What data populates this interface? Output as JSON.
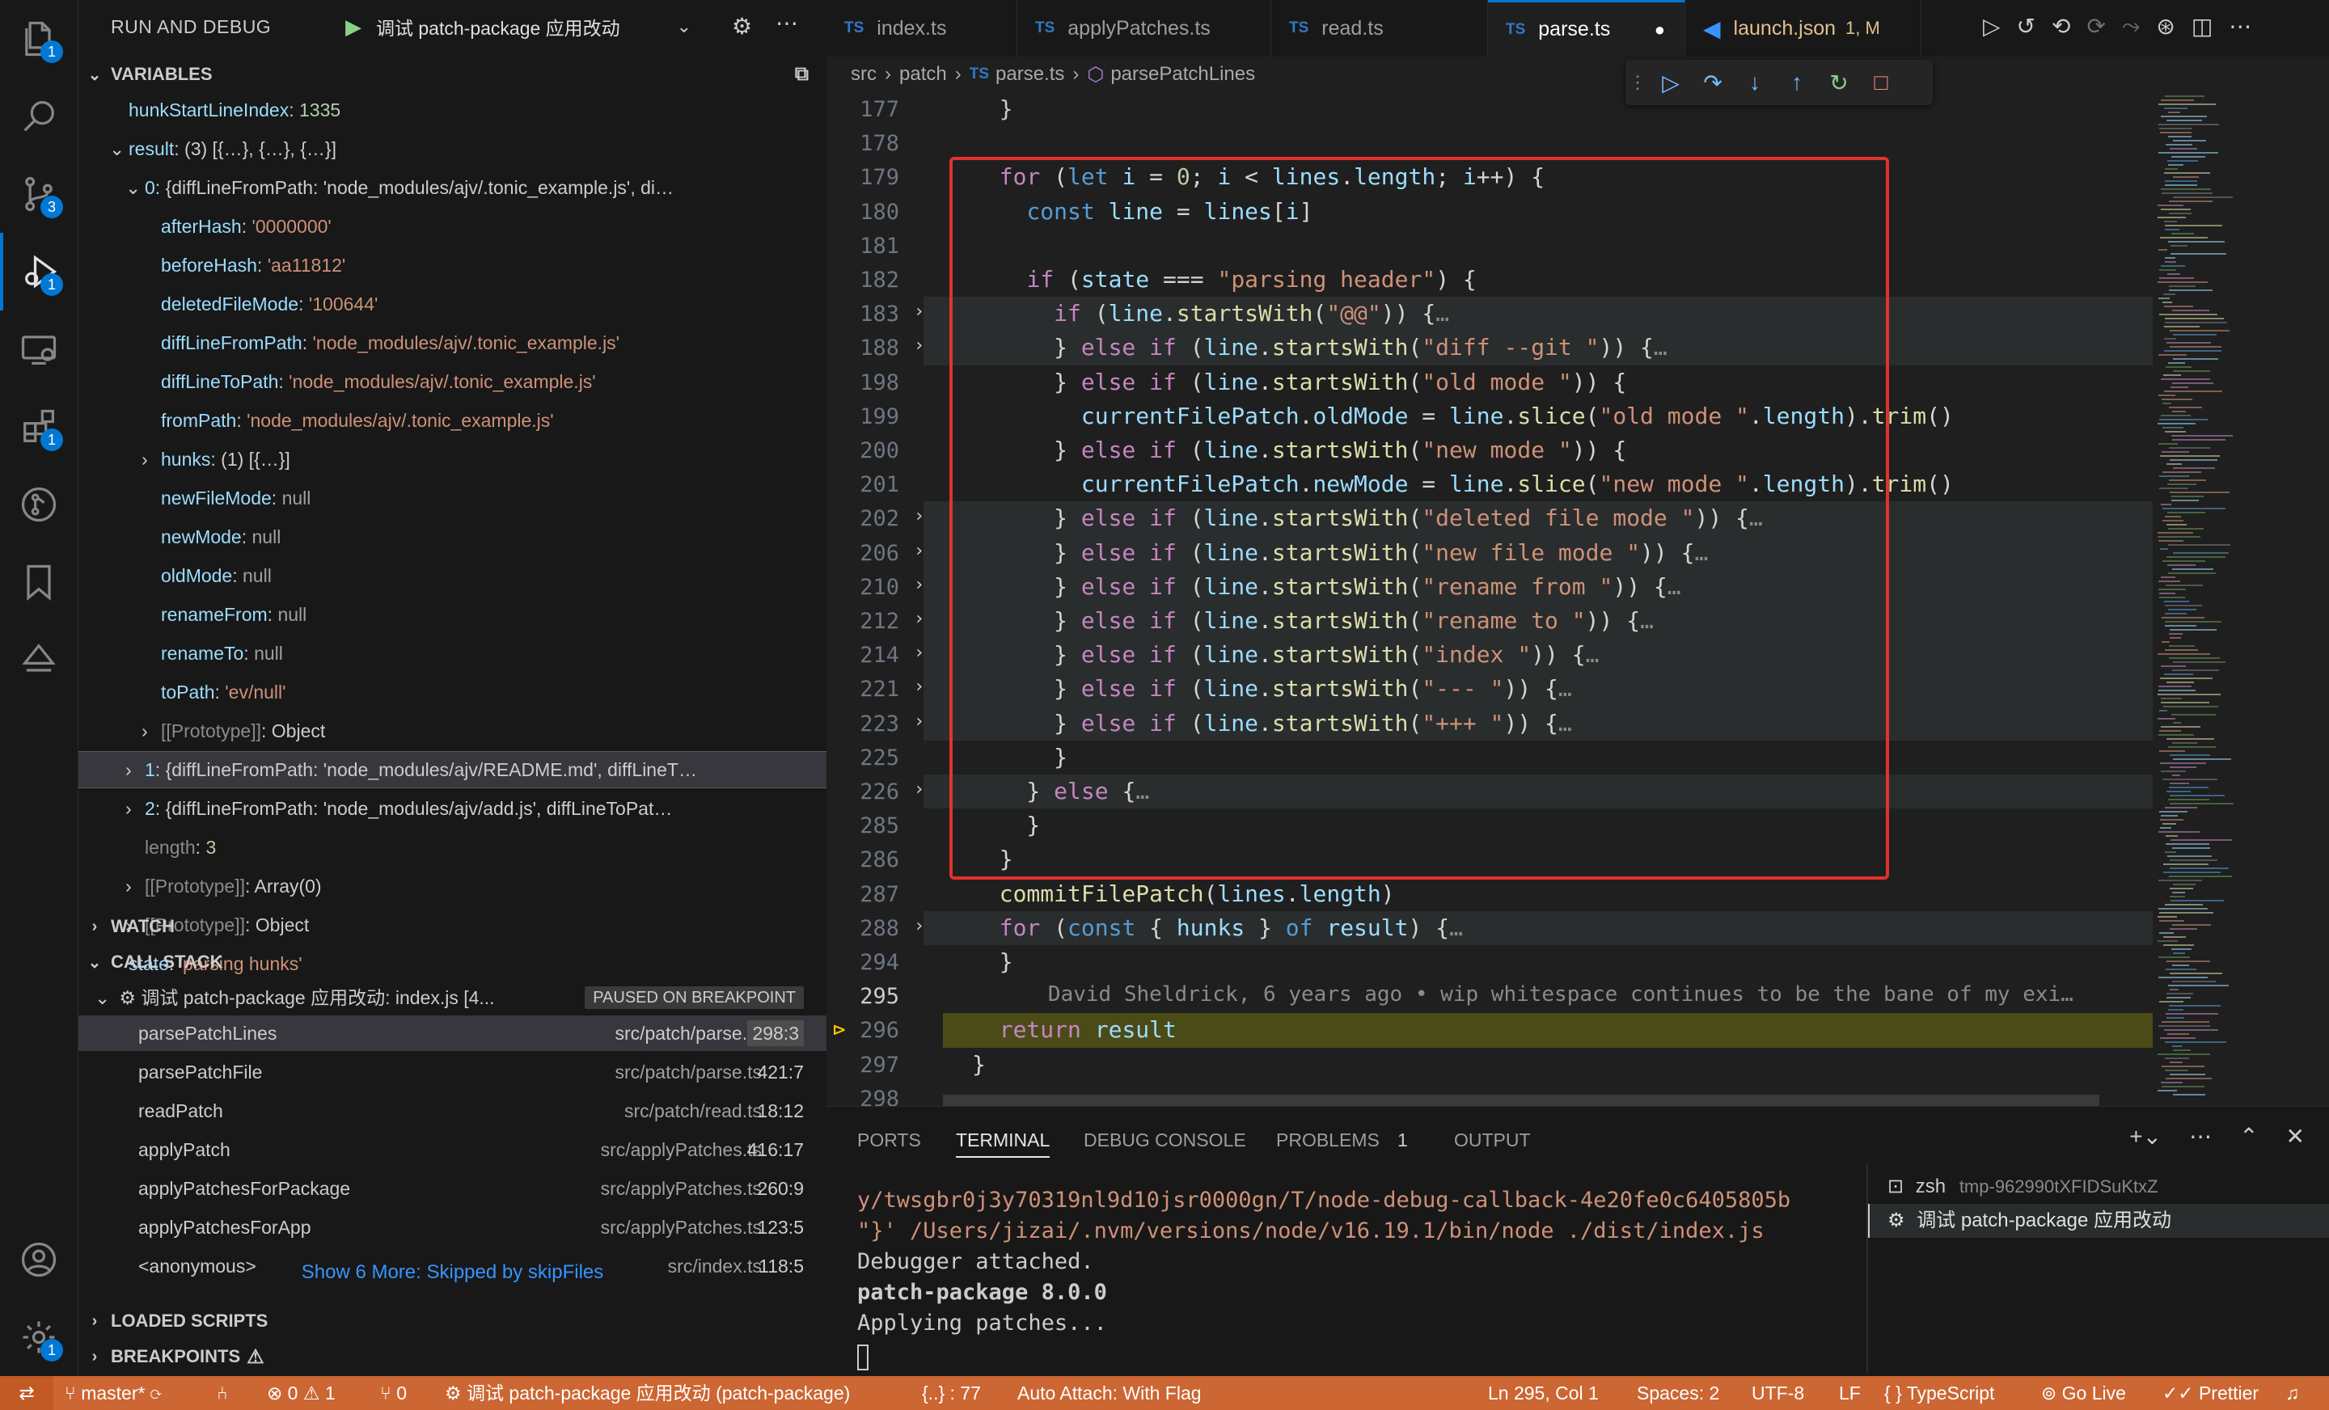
{
  "activity_bar": {
    "badges": {
      "explorer": "1",
      "source_control": "3",
      "run_debug": "1",
      "extensions": "1",
      "settings": "1"
    }
  },
  "sidebar": {
    "title": "RUN AND DEBUG",
    "config_name": "调试 patch-package 应用改动",
    "variables_header": "VARIABLES",
    "variables": [
      {
        "indent": 0,
        "twisty": "",
        "key": "hunkStartLineIndex",
        "sep": ": ",
        "value": "1335",
        "vtype": "n"
      },
      {
        "indent": 0,
        "twisty": "⌄",
        "key": "result",
        "sep": ": ",
        "value": "(3) [{…}, {…}, {…}]",
        "vtype": "p"
      },
      {
        "indent": 1,
        "twisty": "⌄",
        "key": "0",
        "sep": ": ",
        "value": "{diffLineFromPath: 'node_modules/ajv/.tonic_example.js', di…",
        "vtype": "p"
      },
      {
        "indent": 2,
        "twisty": "",
        "key": "afterHash",
        "sep": ": ",
        "value": "'0000000'",
        "vtype": "s"
      },
      {
        "indent": 2,
        "twisty": "",
        "key": "beforeHash",
        "sep": ": ",
        "value": "'aa11812'",
        "vtype": "s"
      },
      {
        "indent": 2,
        "twisty": "",
        "key": "deletedFileMode",
        "sep": ": ",
        "value": "'100644'",
        "vtype": "s"
      },
      {
        "indent": 2,
        "twisty": "",
        "key": "diffLineFromPath",
        "sep": ": ",
        "value": "'node_modules/ajv/.tonic_example.js'",
        "vtype": "s"
      },
      {
        "indent": 2,
        "twisty": "",
        "key": "diffLineToPath",
        "sep": ": ",
        "value": "'node_modules/ajv/.tonic_example.js'",
        "vtype": "s"
      },
      {
        "indent": 2,
        "twisty": "",
        "key": "fromPath",
        "sep": ": ",
        "value": "'node_modules/ajv/.tonic_example.js'",
        "vtype": "s"
      },
      {
        "indent": 2,
        "twisty": "›",
        "key": "hunks",
        "sep": ": ",
        "value": "(1) [{…}]",
        "vtype": "p"
      },
      {
        "indent": 2,
        "twisty": "",
        "key": "newFileMode",
        "sep": ": ",
        "value": "null",
        "vtype": "nul"
      },
      {
        "indent": 2,
        "twisty": "",
        "key": "newMode",
        "sep": ": ",
        "value": "null",
        "vtype": "nul"
      },
      {
        "indent": 2,
        "twisty": "",
        "key": "oldMode",
        "sep": ": ",
        "value": "null",
        "vtype": "nul"
      },
      {
        "indent": 2,
        "twisty": "",
        "key": "renameFrom",
        "sep": ": ",
        "value": "null",
        "vtype": "nul"
      },
      {
        "indent": 2,
        "twisty": "",
        "key": "renameTo",
        "sep": ": ",
        "value": "null",
        "vtype": "nul"
      },
      {
        "indent": 2,
        "twisty": "",
        "key": "toPath",
        "sep": ": ",
        "value": "'ev/null'",
        "vtype": "s"
      },
      {
        "indent": 2,
        "twisty": "›",
        "key": "[[Prototype]]",
        "sep": ": ",
        "value": "Object",
        "vtype": "p"
      },
      {
        "indent": 1,
        "twisty": "›",
        "key": "1",
        "sep": ": ",
        "value": "{diffLineFromPath: 'node_modules/ajv/README.md', diffLineT…",
        "vtype": "p",
        "selected": true
      },
      {
        "indent": 1,
        "twisty": "›",
        "key": "2",
        "sep": ": ",
        "value": "{diffLineFromPath: 'node_modules/ajv/add.js', diffLineToPat…",
        "vtype": "p"
      },
      {
        "indent": 1,
        "twisty": "",
        "key": "length",
        "sep": ": ",
        "value": "3",
        "vtype": "n"
      },
      {
        "indent": 1,
        "twisty": "›",
        "key": "[[Prototype]]",
        "sep": ": ",
        "value": "Array(0)",
        "vtype": "p"
      },
      {
        "indent": 1,
        "twisty": "›",
        "key": "[[Prototype]]",
        "sep": ": ",
        "value": "Object",
        "vtype": "p"
      },
      {
        "indent": 0,
        "twisty": "",
        "key": "state",
        "sep": ": ",
        "value": "'parsing hunks'",
        "vtype": "s"
      }
    ],
    "watch_header": "WATCH",
    "callstack_header": "CALL STACK",
    "callstack_session": "调试 patch-package 应用改动: index.js [4...",
    "paused_badge": "PAUSED ON BREAKPOINT",
    "frames": [
      {
        "fn": "parsePatchLines",
        "file": "src/patch/parse.ts",
        "line": "298:3",
        "selected": true
      },
      {
        "fn": "parsePatchFile",
        "file": "src/patch/parse.ts",
        "line": "421:7"
      },
      {
        "fn": "readPatch",
        "file": "src/patch/read.ts",
        "line": "18:12"
      },
      {
        "fn": "applyPatch",
        "file": "src/applyPatches.ts",
        "line": "416:17"
      },
      {
        "fn": "applyPatchesForPackage",
        "file": "src/applyPatches.ts",
        "line": "260:9"
      },
      {
        "fn": "applyPatchesForApp",
        "file": "src/applyPatches.ts",
        "line": "123:5"
      },
      {
        "fn": "<anonymous>",
        "file": "src/index.ts",
        "line": "118:5"
      }
    ],
    "show_more": "Show 6 More: Skipped by skipFiles",
    "loaded_scripts_header": "LOADED SCRIPTS",
    "breakpoints_header": "BREAKPOINTS"
  },
  "tabs": [
    {
      "label": "index.ts",
      "icon": "TS"
    },
    {
      "label": "applyPatches.ts",
      "icon": "TS"
    },
    {
      "label": "read.ts",
      "icon": "TS"
    },
    {
      "label": "parse.ts",
      "icon": "TS",
      "active": true,
      "dirty": "●"
    },
    {
      "label": "launch.json",
      "icon": "vscode",
      "suffix": "1, M"
    }
  ],
  "breadcrumb": {
    "parts": [
      "src",
      "patch",
      "parse.ts",
      "parsePatchLines"
    ]
  },
  "editor": {
    "lines": [
      {
        "n": "177",
        "html": "  <span class='p'>}</span>"
      },
      {
        "n": "178",
        "html": ""
      },
      {
        "n": "179",
        "html": "  <span class='kw'>for</span> (<span class='kb'>let</span> <span class='vr'>i</span> = <span class='nm'>0</span>; <span class='vr'>i</span> &lt; <span class='vr'>lines</span>.<span class='vr'>length</span>; <span class='vr'>i</span>++) {"
      },
      {
        "n": "180",
        "html": "    <span class='kb'>const</span> <span class='vr'>line</span> = <span class='vr'>lines</span>[<span class='vr'>i</span>]"
      },
      {
        "n": "181",
        "html": ""
      },
      {
        "n": "182",
        "html": "    <span class='kw'>if</span> (<span class='vr'>state</span> === <span class='st'>\"parsing header\"</span>) {"
      },
      {
        "n": "183",
        "fold": true,
        "html": "      <span class='kw'>if</span> (<span class='vr'>line</span>.<span class='fn'>startsWith</span>(<span class='st'>\"@@\"</span>)) {<span class='dim'>…</span>"
      },
      {
        "n": "188",
        "fold": true,
        "html": "      } <span class='kw'>else if</span> (<span class='vr'>line</span>.<span class='fn'>startsWith</span>(<span class='st'>\"diff --git \"</span>)) {<span class='dim'>…</span>"
      },
      {
        "n": "198",
        "html": "      } <span class='kw'>else if</span> (<span class='vr'>line</span>.<span class='fn'>startsWith</span>(<span class='st'>\"old mode \"</span>)) {"
      },
      {
        "n": "199",
        "html": "        <span class='vr'>currentFilePatch</span>.<span class='vr'>oldMode</span> = <span class='vr'>line</span>.<span class='fn'>slice</span>(<span class='st'>\"old mode \"</span>.<span class='vr'>length</span>).<span class='fn'>trim</span>()"
      },
      {
        "n": "200",
        "html": "      } <span class='kw'>else if</span> (<span class='vr'>line</span>.<span class='fn'>startsWith</span>(<span class='st'>\"new mode \"</span>)) {"
      },
      {
        "n": "201",
        "html": "        <span class='vr'>currentFilePatch</span>.<span class='vr'>newMode</span> = <span class='vr'>line</span>.<span class='fn'>slice</span>(<span class='st'>\"new mode \"</span>.<span class='vr'>length</span>).<span class='fn'>trim</span>()"
      },
      {
        "n": "202",
        "fold": true,
        "html": "      } <span class='kw'>else if</span> (<span class='vr'>line</span>.<span class='fn'>startsWith</span>(<span class='st'>\"deleted file mode \"</span>)) {<span class='dim'>…</span>"
      },
      {
        "n": "206",
        "fold": true,
        "html": "      } <span class='kw'>else if</span> (<span class='vr'>line</span>.<span class='fn'>startsWith</span>(<span class='st'>\"new file mode \"</span>)) {<span class='dim'>…</span>"
      },
      {
        "n": "210",
        "fold": true,
        "html": "      } <span class='kw'>else if</span> (<span class='vr'>line</span>.<span class='fn'>startsWith</span>(<span class='st'>\"rename from \"</span>)) {<span class='dim'>…</span>"
      },
      {
        "n": "212",
        "fold": true,
        "html": "      } <span class='kw'>else if</span> (<span class='vr'>line</span>.<span class='fn'>startsWith</span>(<span class='st'>\"rename to \"</span>)) {<span class='dim'>…</span>"
      },
      {
        "n": "214",
        "fold": true,
        "html": "      } <span class='kw'>else if</span> (<span class='vr'>line</span>.<span class='fn'>startsWith</span>(<span class='st'>\"index \"</span>)) {<span class='dim'>…</span>"
      },
      {
        "n": "221",
        "fold": true,
        "html": "      } <span class='kw'>else if</span> (<span class='vr'>line</span>.<span class='fn'>startsWith</span>(<span class='st'>\"--- \"</span>)) {<span class='dim'>…</span>"
      },
      {
        "n": "223",
        "fold": true,
        "html": "      } <span class='kw'>else if</span> (<span class='vr'>line</span>.<span class='fn'>startsWith</span>(<span class='st'>\"+++ \"</span>)) {<span class='dim'>…</span>"
      },
      {
        "n": "225",
        "html": "      }"
      },
      {
        "n": "226",
        "fold": true,
        "html": "    } <span class='kw'>else</span> {<span class='dim'>…</span>"
      },
      {
        "n": "285",
        "html": "    }"
      },
      {
        "n": "286",
        "html": "  }"
      },
      {
        "n": "287",
        "html": "  <span class='fn'>commitFilePatch</span>(<span class='vr'>lines</span>.<span class='vr'>length</span>)"
      },
      {
        "n": "288",
        "fold": true,
        "html": "  <span class='kw'>for</span> (<span class='kb'>const</span> { <span class='vr'>hunks</span> } <span class='kb'>of</span> <span class='vr'>result</span>) {<span class='dim'>…</span>"
      },
      {
        "n": "294",
        "html": "  }"
      },
      {
        "n": "295",
        "cur": true,
        "html": "      <span class='dim'>David Sheldrick, 6 years ago • wip whitespace continues to be the bane of my exi…</span>"
      },
      {
        "n": "296",
        "bp": true,
        "html": "  <span class='kw'>return</span> <span class='vr'>result</span>"
      },
      {
        "n": "297",
        "html": "}"
      },
      {
        "n": "298",
        "html": ""
      }
    ]
  },
  "panel": {
    "tabs": [
      "PORTS",
      "TERMINAL",
      "DEBUG CONSOLE",
      "PROBLEMS",
      "OUTPUT"
    ],
    "problems_count": "1",
    "terminal_lines": [
      {
        "text": "y/twsgbr0j3y70319nl9d10jsr0000gn/T/node-debug-callback-4e20fe0c6405805b",
        "style": "s"
      },
      {
        "text": "\"}' /Users/jizai/.nvm/versions/node/v16.19.1/bin/node ./dist/index.js",
        "style": "s"
      },
      {
        "text": "Debugger attached.",
        "style": "p"
      },
      {
        "text": "patch-package 8.0.0",
        "style": "b"
      },
      {
        "text": "Applying patches...",
        "style": "p"
      }
    ],
    "sessions": [
      {
        "icon": "terminal-icon",
        "name": "zsh",
        "detail": "tmp-962990tXFIDSuKtxZ"
      },
      {
        "icon": "debug-icon",
        "name": "调试 patch-package 应用改动",
        "detail": ""
      }
    ]
  },
  "statusbar": {
    "branch": "master*",
    "errors": "0",
    "warnings": "1",
    "ports": "0",
    "debug_session": "调试 patch-package 应用改动 (patch-package)",
    "braces": "{..} : 77",
    "auto_attach": "Auto Attach: With Flag",
    "position": "Ln 295, Col 1",
    "spaces": "Spaces: 2",
    "encoding": "UTF-8",
    "eol": "LF",
    "language": "TypeScript",
    "golive": "Go Live",
    "prettier": "Prettier"
  }
}
